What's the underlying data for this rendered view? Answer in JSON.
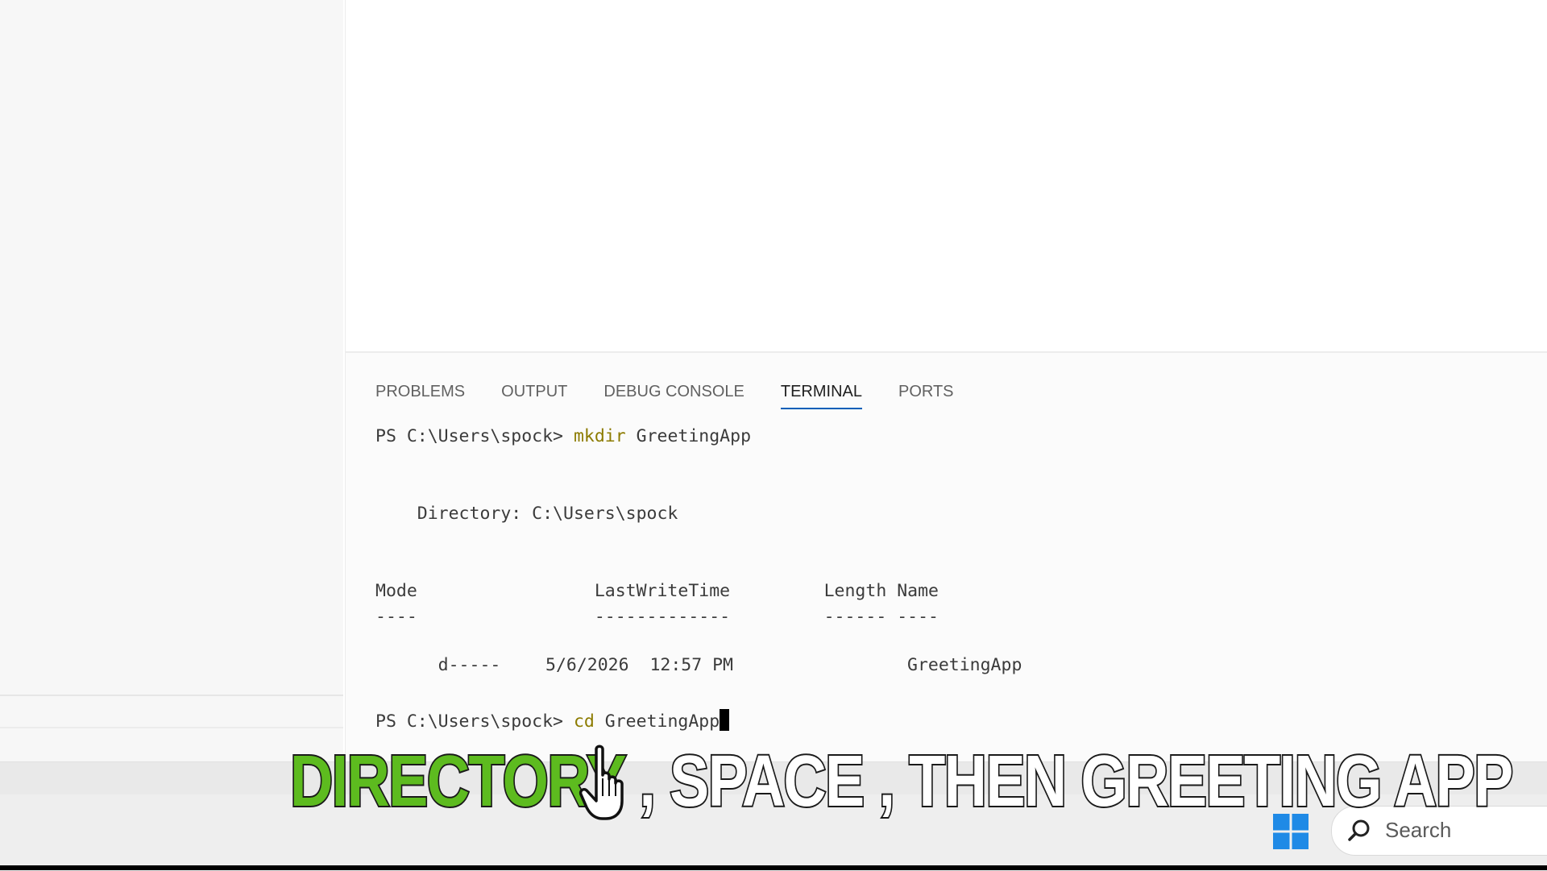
{
  "panel": {
    "tabs": [
      {
        "label": "PROBLEMS",
        "active": false
      },
      {
        "label": "OUTPUT",
        "active": false
      },
      {
        "label": "DEBUG CONSOLE",
        "active": false
      },
      {
        "label": "TERMINAL",
        "active": true
      },
      {
        "label": "PORTS",
        "active": false
      }
    ]
  },
  "terminal": {
    "prompt1": "PS C:\\Users\\spock> ",
    "cmd1_name": "mkdir",
    "cmd1_arg": " GreetingApp",
    "directory_line": "    Directory: C:\\Users\\spock",
    "header_line": "Mode                 LastWriteTime         Length Name",
    "separator_line": "----                 -------------         ------ ----",
    "row_mode": "d-----",
    "row_lastwrite": "5/6/2026  12:57 PM",
    "row_name": "GreetingApp",
    "prompt2": "PS C:\\Users\\spock> ",
    "cmd2_name": "cd",
    "cmd2_arg": " GreetingApp"
  },
  "caption": {
    "highlight": "DIRECTORY",
    "rest": " , SPACE , THEN GREETING APP"
  },
  "taskbar": {
    "search_label": "Search"
  },
  "colors": {
    "caption_highlight": "#5dbb1f",
    "command": "#8c7b00",
    "active_tab_underline": "#005fb8"
  }
}
